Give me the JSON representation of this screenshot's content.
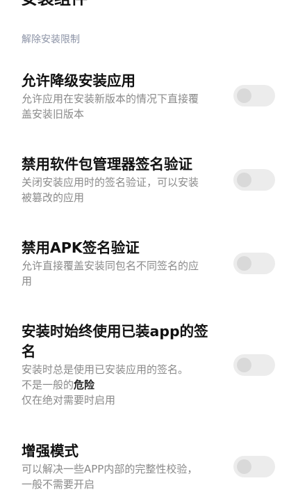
{
  "header": {
    "partial_title": "安装组件"
  },
  "section": {
    "title": "解除安装限制"
  },
  "settings": [
    {
      "title": "允许降级安装应用",
      "desc_lines": [
        "允许应用在安装新版本的情况下直接覆",
        "盖安装旧版本"
      ],
      "enabled": false
    },
    {
      "title": "禁用软件包管理器签名验证",
      "desc_lines": [
        "关闭安装应用时的签名验证，可以安装",
        "被篡改的应用"
      ],
      "enabled": false
    },
    {
      "title": "禁用APK签名验证",
      "desc_lines": [
        "允许直接覆盖安装同包名不同签名的应",
        "用"
      ],
      "enabled": false
    },
    {
      "title_lines": [
        "安装时始终使用已装app的签",
        "名"
      ],
      "desc_line1": "安装时总是使用已安装应用的签名。",
      "desc_line2_prefix": "不是一般的",
      "desc_line2_danger": "危险",
      "desc_line3": "仅在绝对需要时启用",
      "enabled": false
    },
    {
      "title": "增强模式",
      "desc_lines": [
        "可以解决一些APP内部的完整性校验，",
        "一般不需要开启"
      ],
      "enabled": false
    }
  ],
  "colors": {
    "section_header": "#8c93a6",
    "title": "#111111",
    "description": "#8a8a8a",
    "toggle_track_off": "#ececec",
    "toggle_knob_off": "#d9d9d9"
  }
}
